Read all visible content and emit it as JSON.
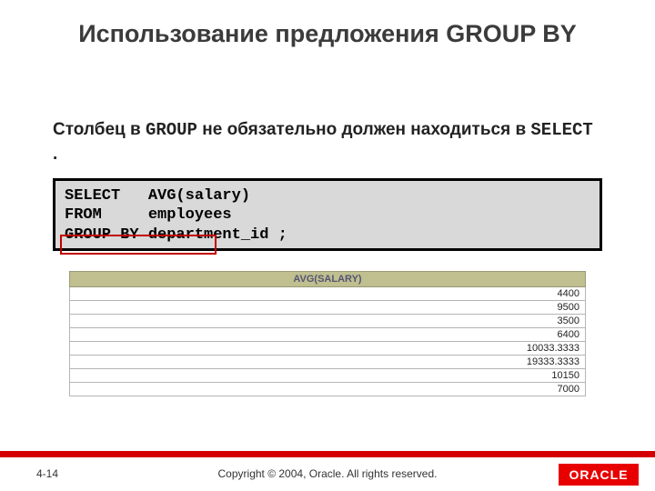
{
  "title": "Использование предложения GROUP BY",
  "subtitle_parts": {
    "p1": "Столбец в ",
    "kw1": "GROUP",
    "p2": " не обязательно должен находиться в ",
    "kw2": "SELECT",
    "p3": " ."
  },
  "code": "SELECT   AVG(salary)\nFROM     employees\nGROUP BY department_id ;",
  "result": {
    "header": "AVG(SALARY)",
    "rows": [
      "4400",
      "9500",
      "3500",
      "6400",
      "10033.3333",
      "19333.3333",
      "10150",
      "7000"
    ]
  },
  "footer": {
    "slide_number": "4-14",
    "copyright": "Copyright © 2004, Oracle.  All rights reserved.",
    "logo_text": "ORACLE"
  },
  "chart_data": {
    "type": "table",
    "title": "AVG(SALARY)",
    "columns": [
      "AVG(SALARY)"
    ],
    "rows": [
      [
        4400
      ],
      [
        9500
      ],
      [
        3500
      ],
      [
        6400
      ],
      [
        10033.3333
      ],
      [
        19333.3333
      ],
      [
        10150
      ],
      [
        7000
      ]
    ]
  }
}
